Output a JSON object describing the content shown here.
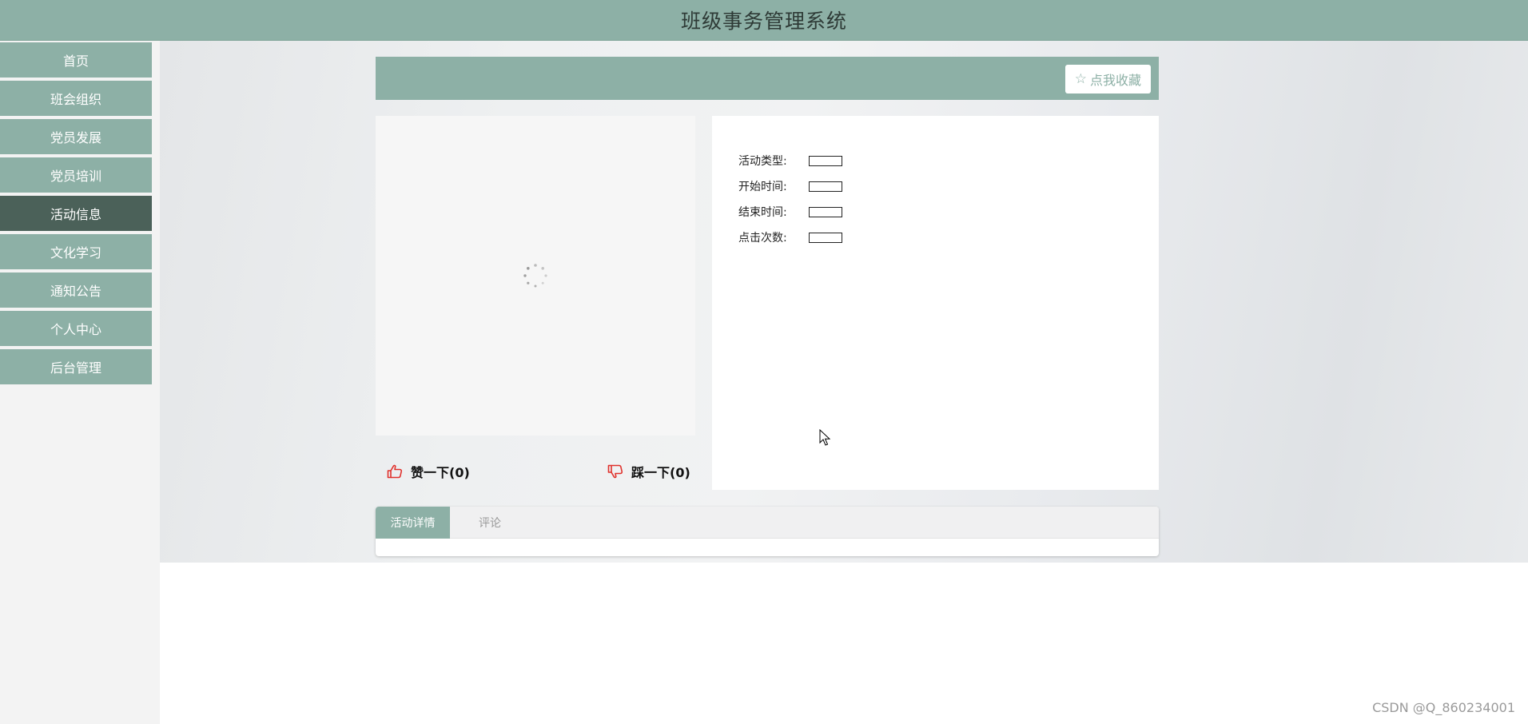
{
  "header": {
    "title": "班级事务管理系统"
  },
  "sidebar": {
    "items": [
      {
        "label": "首页"
      },
      {
        "label": "班会组织"
      },
      {
        "label": "党员发展"
      },
      {
        "label": "党员培训"
      },
      {
        "label": "活动信息",
        "active": true
      },
      {
        "label": "文化学习"
      },
      {
        "label": "通知公告"
      },
      {
        "label": "个人中心"
      },
      {
        "label": "后台管理"
      }
    ]
  },
  "detail": {
    "favorite_label": "点我收藏",
    "favorite_icon": "star-outline-icon",
    "like_label": "赞一下(0)",
    "like_icon": "thumbs-up-icon",
    "dislike_label": "踩一下(0)",
    "dislike_icon": "thumbs-down-icon",
    "info": {
      "type_label": "活动类型:",
      "start_label": "开始时间:",
      "end_label": "结束时间:",
      "clicks_label": "点击次数:"
    }
  },
  "tabs": [
    {
      "label": "活动详情",
      "active": true
    },
    {
      "label": "评论"
    }
  ],
  "watermark": "CSDN @Q_860234001",
  "colors": {
    "theme": "#8db0a6",
    "active_nav": "#4b6159",
    "vote_icon": "#e0312c"
  }
}
